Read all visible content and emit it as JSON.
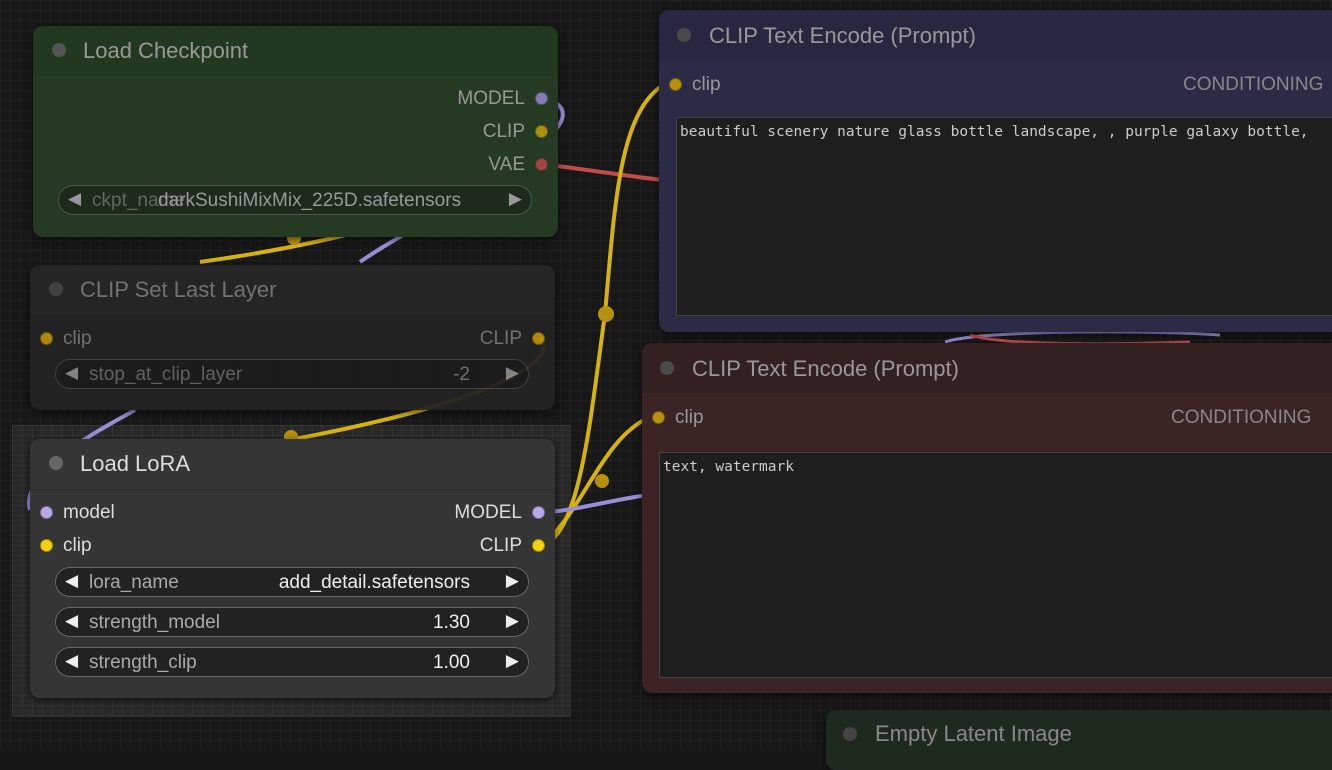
{
  "colors": {
    "model_wire": "#9b8cd6",
    "clip_wire": "#d6b30c",
    "vae_wire": "#c04b4b",
    "checkpoint_body": "#243a22",
    "positive_body": "#2b2b45",
    "negative_body": "#3a2424"
  },
  "load_checkpoint": {
    "title": "Load Checkpoint",
    "outputs": [
      "MODEL",
      "CLIP",
      "VAE"
    ],
    "ckpt_label": "ckpt_name",
    "ckpt_value": "darkSushiMixMix_225D.safetensors"
  },
  "clip_set_last_layer": {
    "title": "CLIP Set Last Layer",
    "input": "clip",
    "output": "CLIP",
    "stop_label": "stop_at_clip_layer",
    "stop_value": "-2"
  },
  "load_lora": {
    "title": "Load LoRA",
    "inputs": [
      "model",
      "clip"
    ],
    "outputs": [
      "MODEL",
      "CLIP"
    ],
    "lora_label": "lora_name",
    "lora_value": "add_detail.safetensors",
    "strength_model_label": "strength_model",
    "strength_model_value": "1.30",
    "strength_clip_label": "strength_clip",
    "strength_clip_value": "1.00"
  },
  "clip_text_positive": {
    "title": "CLIP Text Encode (Prompt)",
    "input": "clip",
    "output": "CONDITIONING",
    "text": "beautiful scenery nature glass bottle landscape, , purple galaxy bottle,"
  },
  "clip_text_negative": {
    "title": "CLIP Text Encode (Prompt)",
    "input": "clip",
    "output": "CONDITIONING",
    "text": "text, watermark"
  },
  "empty_latent": {
    "title": "Empty Latent Image"
  },
  "icons": {
    "arrow_left": "◀",
    "arrow_right": "▶"
  }
}
